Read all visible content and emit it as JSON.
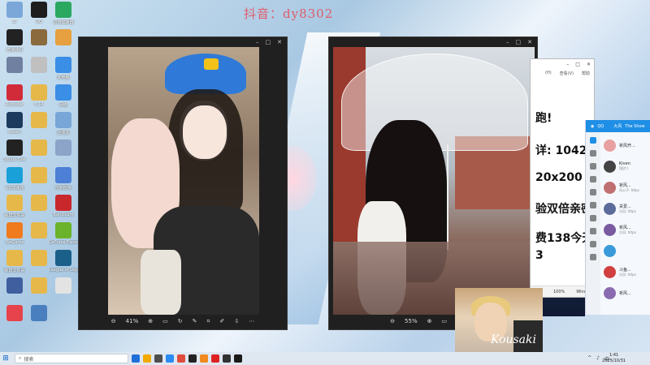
{
  "watermark": "抖音：dy8302",
  "desktop_icons": [
    {
      "label": "Zr",
      "color": "#7aa7d8"
    },
    {
      "label": "QQ",
      "color": "#1e1e1e"
    },
    {
      "label": "迅游加速器",
      "color": "#2aa860"
    },
    {
      "label": "直播伴侣",
      "color": "#222"
    },
    {
      "label": "",
      "color": "#8b6a3e"
    },
    {
      "label": "",
      "color": "#e6a040"
    },
    {
      "label": "",
      "color": "#7080a0"
    },
    {
      "label": "",
      "color": "#c0c0c0"
    },
    {
      "label": "此电脑",
      "color": "#3a8ee6"
    },
    {
      "label": "Rockstar",
      "color": "#d12b3a"
    },
    {
      "label": "5.14",
      "color": "#e6b84a"
    },
    {
      "label": "网络",
      "color": "#3a8ee6"
    },
    {
      "label": "Steam",
      "color": "#1b3a5e"
    },
    {
      "label": "",
      "color": "#e6b84a"
    },
    {
      "label": "回收站",
      "color": "#78a6d6"
    },
    {
      "label": "Studio One",
      "color": "#222"
    },
    {
      "label": "",
      "color": "#e6b84a"
    },
    {
      "label": "",
      "color": "#8ba4c8"
    },
    {
      "label": "UU加速器",
      "color": "#19a0d8"
    },
    {
      "label": "",
      "color": "#e6b84a"
    },
    {
      "label": "控制面板",
      "color": "#4d7fd6"
    },
    {
      "label": "新建文件夹",
      "color": "#e6b84a"
    },
    {
      "label": "",
      "color": "#e6b84a"
    },
    {
      "label": "Bandicam",
      "color": "#c8282c"
    },
    {
      "label": "WeGame",
      "color": "#f07a1e"
    },
    {
      "label": "",
      "color": "#e6b84a"
    },
    {
      "label": "GeForce Experience",
      "color": "#6ab32a"
    },
    {
      "label": "新建文件夹",
      "color": "#e6b84a"
    },
    {
      "label": "",
      "color": "#e6b84a"
    },
    {
      "label": "League of Legends",
      "color": "#1a5f8a"
    },
    {
      "label": "",
      "color": "#3f5f9f"
    },
    {
      "label": "",
      "color": "#e6b84a"
    },
    {
      "label": "",
      "color": "#e3e3e3"
    },
    {
      "label": "",
      "color": "#e7434c"
    },
    {
      "label": "",
      "color": "#4a7fbf"
    }
  ],
  "viewer_left": {
    "zoom": "41%"
  },
  "viewer_right": {
    "zoom": "55%"
  },
  "doc": {
    "menu": [
      "(H)",
      "查看(V)",
      "帮助"
    ],
    "lines": [
      "跑!",
      "详: 1042",
      "20x200",
      "验双倍亲密",
      "费138今天",
      "3"
    ],
    "status": [
      "100%",
      "Windows"
    ]
  },
  "qq": {
    "brand": "QQ",
    "user": "大风",
    "title": "The Show",
    "chats": [
      {
        "name": "祈风开...",
        "preview": "",
        "color": "#e8a0a0"
      },
      {
        "name": "Kiven",
        "preview": "[图片]",
        "color": "#444"
      },
      {
        "name": "祈风...",
        "preview": "风公子: https",
        "color": "#c07070"
      },
      {
        "name": "关爱...",
        "preview": "大风: https",
        "color": "#5b6b9b"
      },
      {
        "name": "祈风...",
        "preview": "大风: https",
        "color": "#7a5ba0"
      },
      {
        "name": "",
        "preview": "",
        "color": "#3a9ad9"
      },
      {
        "name": "斗鱼...",
        "preview": "大风: https",
        "color": "#d04040"
      },
      {
        "name": "祈风...",
        "preview": "",
        "color": "#8a6bb0"
      }
    ]
  },
  "cam_mark": "Kousaki",
  "taskbar": {
    "search_placeholder": "搜索",
    "apps": [
      "#1f6fd9",
      "#f2a900",
      "#4e4e4e",
      "#2b8bf5",
      "#e04c3c",
      "#222",
      "#f08a1e",
      "#d22",
      "#333",
      "#1a1a1a"
    ],
    "tray": "中",
    "time": "1:41",
    "date": "2025/10/31"
  }
}
